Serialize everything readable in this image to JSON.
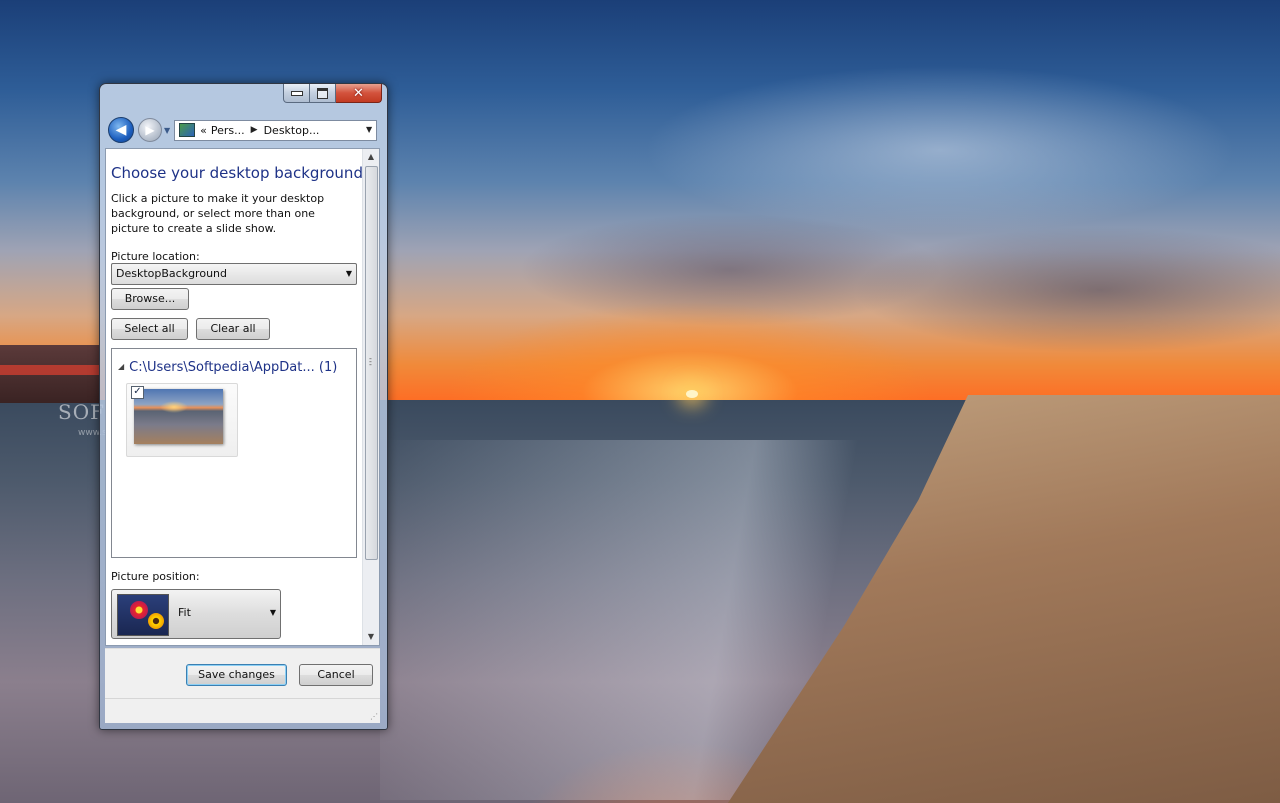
{
  "desktop": {
    "watermark": "SOFTPEDIA",
    "watermark_url": "www.softpedia.com"
  },
  "window": {
    "address": {
      "back_glyph": "◀",
      "forward_glyph": "▶",
      "prefix": "«",
      "crumbs": [
        "Pers...",
        "Desktop..."
      ],
      "icon": "control-panel-icon"
    },
    "header": {
      "title": "Choose your desktop background",
      "description": "Click a picture to make it your desktop background, or select more than one picture to create a slide show."
    },
    "picture_location": {
      "label": "Picture location:",
      "selected": "DesktopBackground",
      "browse_label": "Browse..."
    },
    "select_all_label": "Select all",
    "clear_all_label": "Clear all",
    "gallery": {
      "group_header": "C:\\Users\\Softpedia\\AppDat... (1)",
      "items": [
        {
          "checked": true
        }
      ]
    },
    "picture_position": {
      "label": "Picture position:",
      "selected": "Fit"
    },
    "footer": {
      "save_label": "Save changes",
      "cancel_label": "Cancel"
    }
  },
  "colors": {
    "accent_title": "#1e3287",
    "close_button": "#c23a22",
    "default_button_border": "#3c7fb1"
  }
}
